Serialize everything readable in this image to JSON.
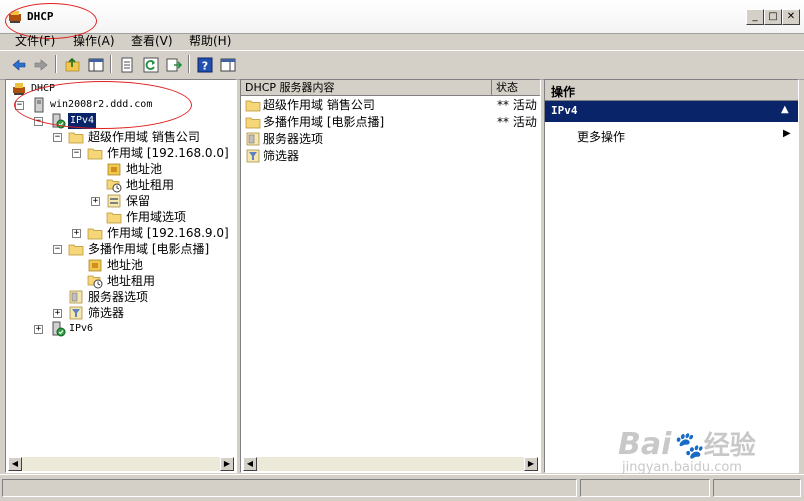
{
  "window": {
    "title": "DHCP"
  },
  "menu": [
    "文件(F)",
    "操作(A)",
    "查看(V)",
    "帮助(H)"
  ],
  "toolbar": {
    "buttons": [
      "back-arrow-icon",
      "forward-arrow-icon",
      "up-folder-icon",
      "show-hide-tree-icon",
      "properties-icon",
      "refresh-icon",
      "export-list-icon",
      "help-icon",
      "show-hide-action-pane-icon"
    ]
  },
  "tree": {
    "root": "DHCP",
    "server": "win2008r2.ddd.com",
    "ipv4": "IPv4",
    "superscope": "超级作用域 销售公司",
    "scope1": "作用域 [192.168.0.0]",
    "pool": "地址池",
    "leases": "地址租用",
    "reservations": "保留",
    "scope_options": "作用域选项",
    "scope2": "作用域 [192.168.9.0]",
    "multicast": "多播作用域 [电影点播]",
    "mc_pool": "地址池",
    "mc_leases": "地址租用",
    "server_options": "服务器选项",
    "filters": "筛选器",
    "ipv6": "IPv6"
  },
  "list": {
    "col_content": "DHCP 服务器内容",
    "col_status": "状态",
    "rows": [
      {
        "name": "超级作用域 销售公司",
        "status": "** 活动"
      },
      {
        "name": "多播作用域 [电影点播]",
        "status": "** 活动"
      },
      {
        "name": "服务器选项",
        "status": ""
      },
      {
        "name": "筛选器",
        "status": ""
      }
    ]
  },
  "actions": {
    "title": "操作",
    "section": "IPv4",
    "more": "更多操作"
  },
  "watermark": {
    "brand": "Bai",
    "brand2": "经验",
    "url": "jingyan.baidu.com"
  }
}
